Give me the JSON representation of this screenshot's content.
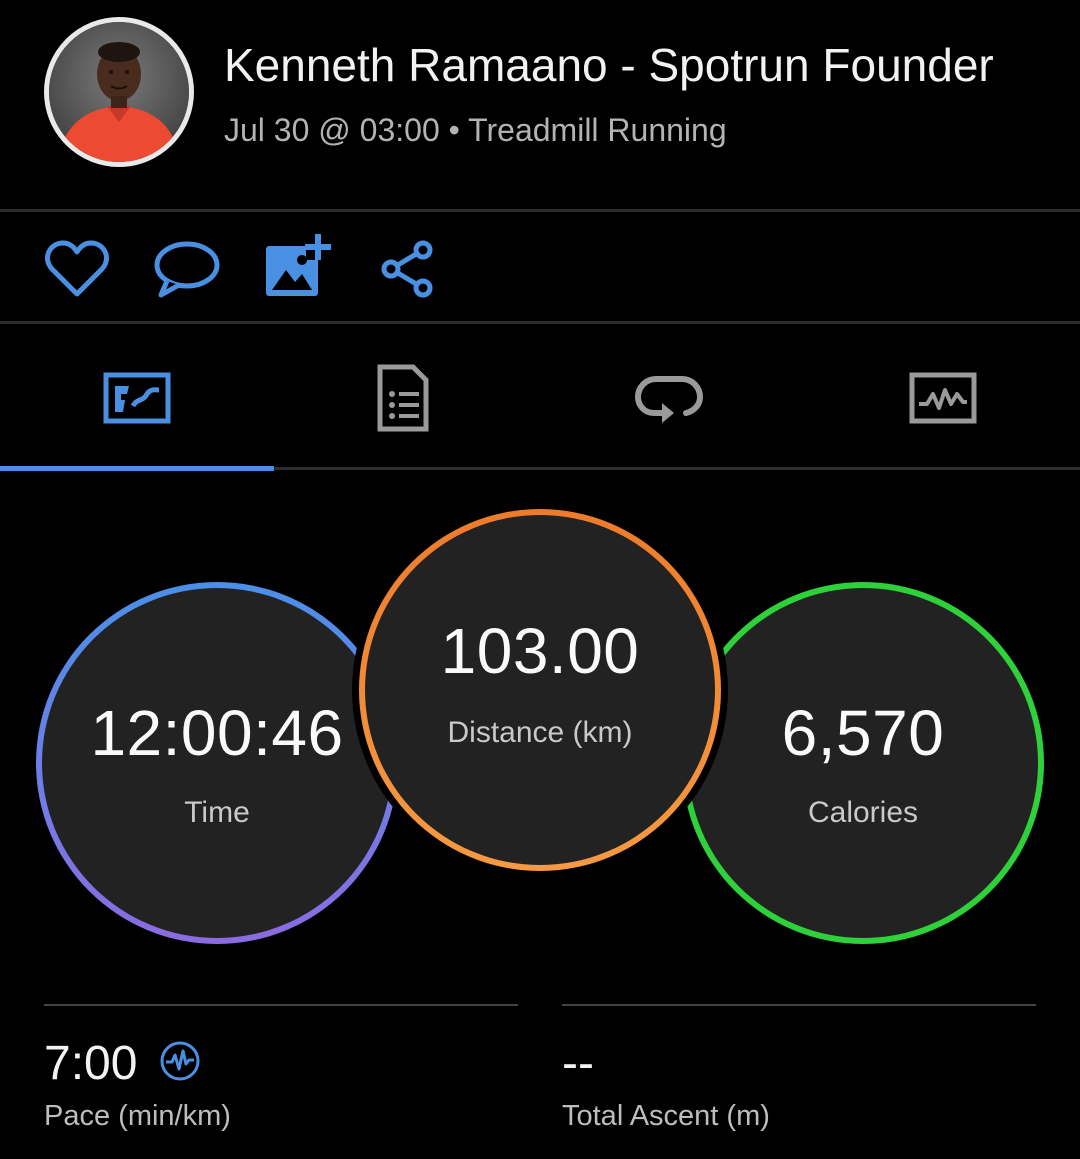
{
  "header": {
    "name": "Kenneth Ramaano - Spotrun Founder",
    "subtitle": "Jul 30 @ 03:00 • Treadmill Running"
  },
  "actions": [
    {
      "name": "like",
      "icon": "heart-icon"
    },
    {
      "name": "comment",
      "icon": "comment-bubble-icon"
    },
    {
      "name": "add-photo",
      "icon": "add-photo-icon"
    },
    {
      "name": "share",
      "icon": "share-icon"
    }
  ],
  "tabs": [
    {
      "name": "overview",
      "icon": "map-overview-icon",
      "active": true
    },
    {
      "name": "details",
      "icon": "document-list-icon",
      "active": false
    },
    {
      "name": "laps",
      "icon": "loop-icon",
      "active": false
    },
    {
      "name": "charts",
      "icon": "graph-icon",
      "active": false
    }
  ],
  "metrics": {
    "time": {
      "value": "12:00:46",
      "label": "Time"
    },
    "distance": {
      "value": "103.00",
      "label": "Distance (km)"
    },
    "calories": {
      "value": "6,570",
      "label": "Calories"
    }
  },
  "stats": {
    "pace": {
      "value": "7:00",
      "label": "Pace (min/km)",
      "icon": "heart-rate-icon"
    },
    "ascent": {
      "value": "--",
      "label": "Total Ascent (m)"
    }
  },
  "colors": {
    "accent": "#4a90e2",
    "time_ring_start": "#4a8fe8",
    "time_ring_end": "#8a6be0",
    "distance_ring": "#f08a2c",
    "calories_ring": "#2ed13a"
  }
}
